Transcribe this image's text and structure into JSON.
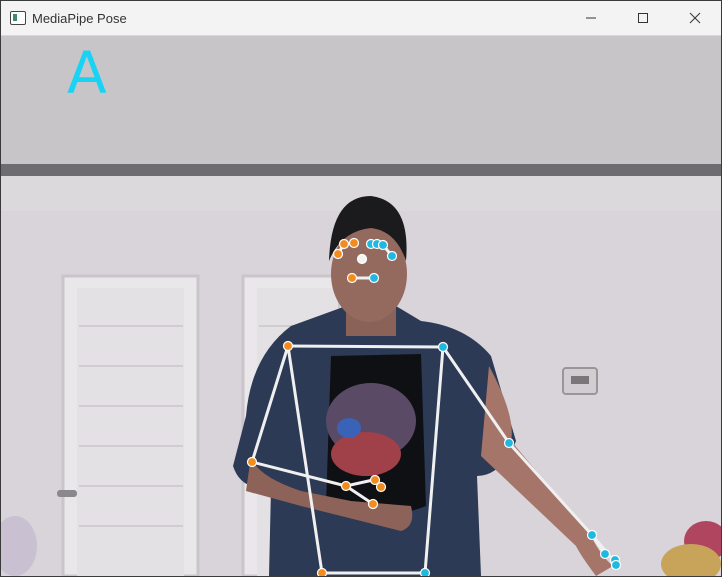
{
  "window": {
    "title": "MediaPipe Pose",
    "icon": "app-window-icon",
    "controls": {
      "minimize_icon": "minimize-icon",
      "maximize_icon": "maximize-icon",
      "close_icon": "close-icon"
    }
  },
  "overlay": {
    "gesture_letter": "A",
    "letter_color": "#19d3f5",
    "left_landmark_color": "#f28c1f",
    "right_landmark_color": "#1fb8e0",
    "center_landmark_color": "#ffffff",
    "connection_color": "#ffffff"
  }
}
